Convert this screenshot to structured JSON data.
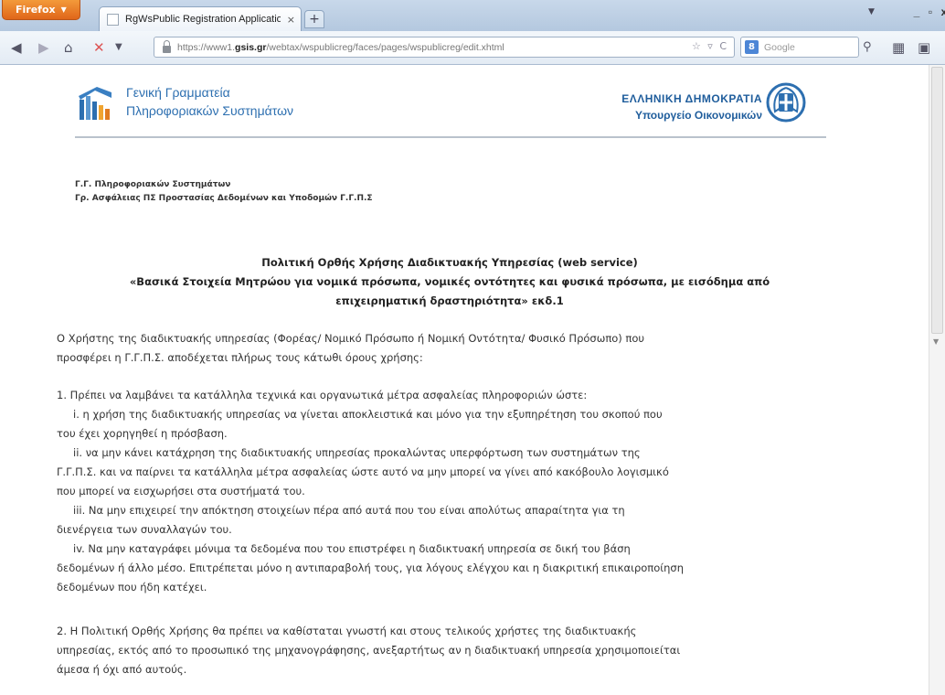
{
  "browser": {
    "app_button": "Firefox",
    "tab_title": "RgWsPublic Registration Application ...",
    "tab_close": "×",
    "new_tab": "+",
    "url_prefix": "https://www1.",
    "url_domain": "gsis.gr",
    "url_path": "/webtax/wspublicreg/faces/pages/wspublicreg/edit.xhtml",
    "search_placeholder": "Google",
    "search_engine_letter": "8",
    "window_controls": [
      "_",
      "▫",
      "x"
    ]
  },
  "header": {
    "left_line1": "Γενική Γραμματεία",
    "left_line2": "Πληροφοριακών Συστημάτων",
    "right_line1": "ΕΛΛΗΝΙΚΗ ΔΗΜΟΚΡΑΤΙΑ",
    "right_line2": "Υπουργείο Οικονομικών"
  },
  "org_lines": [
    "Γ.Γ. Πληροφοριακών Συστημάτων",
    "Γρ. Ασφάλειας ΠΣ Προστασίας Δεδομένων και Υποδομών Γ.Γ.Π.Σ"
  ],
  "policy_title": [
    "Πολιτική Ορθής Χρήσης Διαδικτυακής Υπηρεσίας (web service)",
    "«Βασικά Στοιχεία Μητρώου για νομικά πρόσωπα, νομικές οντότητες και φυσικά πρόσωπα, με εισόδημα από",
    "επιχειρηματική δραστηριότητα» εκδ.1"
  ],
  "intro": [
    "Ο Χρήστης της διαδικτυακής υπηρεσίας (Φορέας/ Νομικό Πρόσωπο ή Νομική Οντότητα/ Φυσικό Πρόσωπο) που",
    "προσφέρει η Γ.Γ.Π.Σ. αποδέχεται πλήρως τους κάτωθι όρους χρήσης:"
  ],
  "section1": {
    "lead": "1.   Πρέπει να λαμβάνει τα κατάλληλα τεχνικά και οργανωτικά μέτρα ασφαλείας πληροφοριών ώστε:",
    "lines": [
      "i.  η χρήση της διαδικτυακής υπηρεσίας να γίνεται αποκλειστικά και μόνο για την εξυπηρέτηση του σκοπού που",
      "του έχει χορηγηθεί η πρόσβαση.",
      "ii.  να μην κάνει κατάχρηση της διαδικτυακής υπηρεσίας προκαλώντας υπερφόρτωση των συστημάτων της",
      "Γ.Γ.Π.Σ. και να παίρνει τα κατάλληλα μέτρα ασφαλείας ώστε αυτό να μην μπορεί να γίνει από κακόβουλο λογισμικό",
      "που μπορεί να εισχωρήσει στα συστήματά του.",
      "iii.  Να μην επιχειρεί την απόκτηση στοιχείων πέρα από αυτά που του είναι απολύτως απαραίτητα για τη",
      "διενέργεια των συναλλαγών του.",
      "iv.  Να μην καταγράφει μόνιμα τα δεδομένα που του επιστρέφει η διαδικτυακή υπηρεσία σε δική του βάση",
      "δεδομένων ή άλλο μέσο. Επιτρέπεται μόνο η αντιπαραβολή τους, για λόγους ελέγχου και η διακριτική επικαιροποίηση",
      "δεδομένων που ήδη κατέχει."
    ]
  },
  "section2": [
    "2.   Η Πολιτική Ορθής Χρήσης θα πρέπει να καθίσταται γνωστή και στους τελικούς χρήστες της διαδικτυακής",
    "υπηρεσίας, εκτός από το προσωπικό της μηχανογράφησης, ανεξαρτήτως αν η διαδικτυακή υπηρεσία χρησιμοποιείται",
    "άμεσα ή όχι από αυτούς."
  ]
}
